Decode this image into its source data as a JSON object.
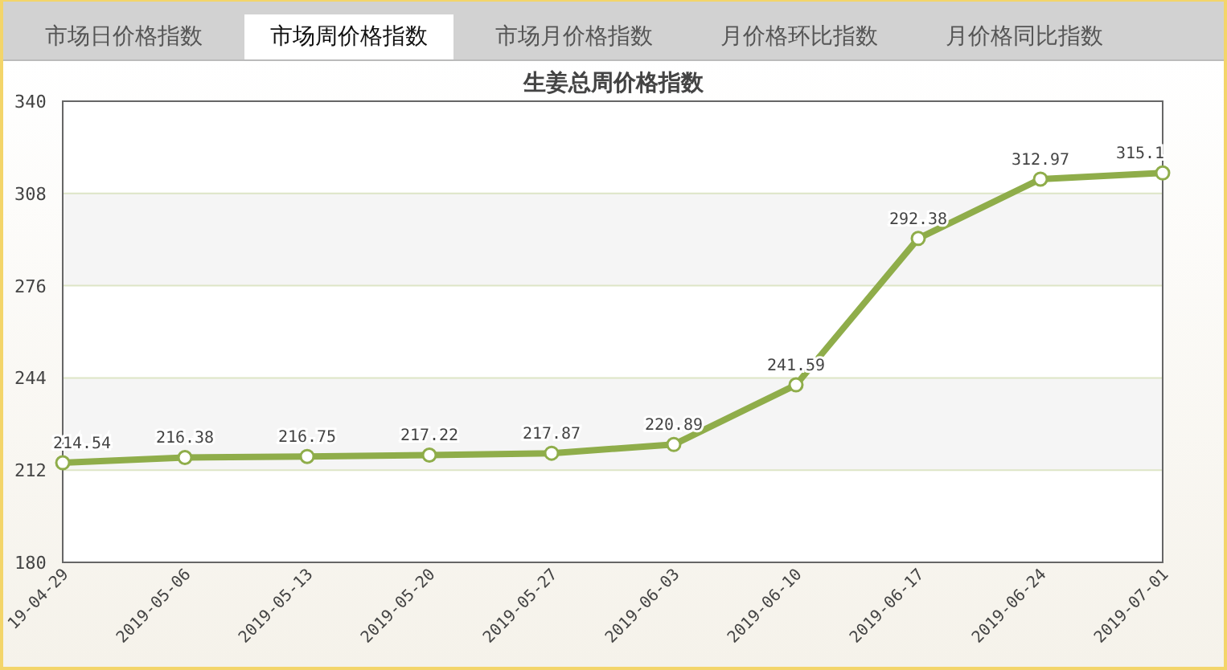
{
  "tabs": [
    {
      "label": "市场日价格指数",
      "selected": false
    },
    {
      "label": "市场周价格指数",
      "selected": true
    },
    {
      "label": "市场月价格指数",
      "selected": false
    },
    {
      "label": "月价格环比指数",
      "selected": false
    },
    {
      "label": "月价格同比指数",
      "selected": false
    }
  ],
  "chart": {
    "chart_data": {
      "type": "line",
      "title": "生姜总周价格指数",
      "categories": [
        "19-04-29",
        "2019-05-06",
        "2019-05-13",
        "2019-05-20",
        "2019-05-27",
        "2019-06-03",
        "2019-06-10",
        "2019-06-17",
        "2019-06-24",
        "2019-07-01"
      ],
      "series": [
        {
          "color": "#8fad4a",
          "marker": "circle",
          "values": [
            214.54,
            216.38,
            216.75,
            217.22,
            217.87,
            220.89,
            241.59,
            292.38,
            312.97,
            315.1
          ]
        }
      ],
      "ylim": [
        180,
        340
      ],
      "yticks": [
        180,
        212,
        244,
        276,
        308,
        340
      ],
      "data_labels": true,
      "grid": true
    }
  }
}
